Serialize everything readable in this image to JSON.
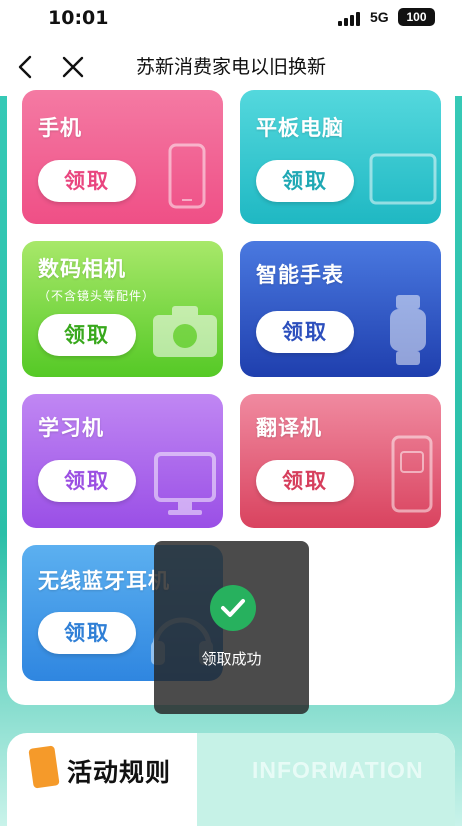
{
  "status_bar": {
    "time": "10:01",
    "network": "5G",
    "battery": "100"
  },
  "nav": {
    "title": "苏新消费家电以旧换新"
  },
  "cards": [
    {
      "title": "手机",
      "button": "领取"
    },
    {
      "title": "平板电脑",
      "button": "领取"
    },
    {
      "title": "数码相机",
      "subtitle": "（不含镜头等配件）",
      "button": "领取"
    },
    {
      "title": "智能手表",
      "button": "领取"
    },
    {
      "title": "学习机",
      "button": "领取"
    },
    {
      "title": "翻译机",
      "button": "领取"
    },
    {
      "title": "无线蓝牙耳机",
      "button": "领取"
    }
  ],
  "toast": {
    "message": "领取成功"
  },
  "rules": {
    "title": "活动规则",
    "subtitle": "INFORMATION"
  },
  "colors": {
    "teal_bg": "#2bbfa8",
    "pink": "#f25e93",
    "cyan": "#2cc6cc",
    "green": "#6cd13a",
    "blue": "#2d55c8",
    "purple": "#a55ae9",
    "red": "#e04e6a",
    "sky": "#3a93e6",
    "toast_check": "#27b15e"
  }
}
